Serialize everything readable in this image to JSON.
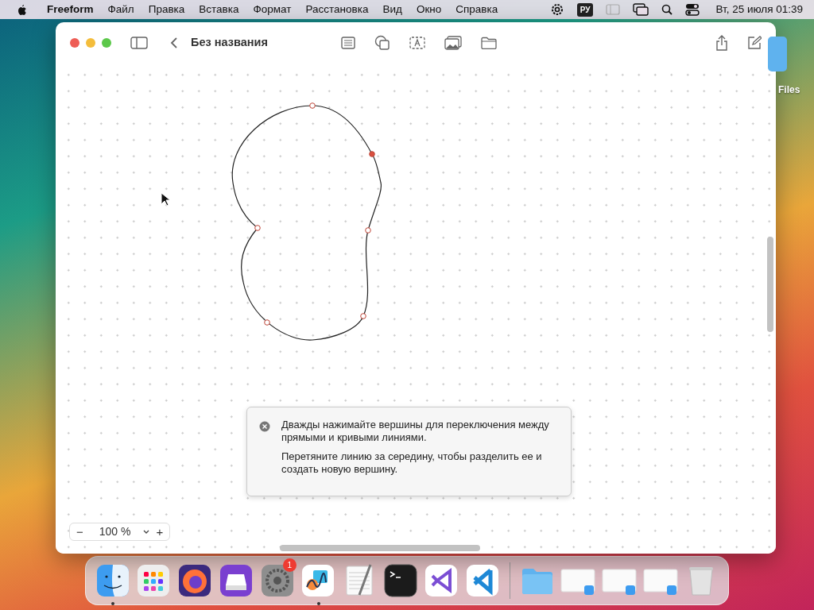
{
  "menubar": {
    "app_name": "Freeform",
    "menus": [
      "Файл",
      "Правка",
      "Вставка",
      "Формат",
      "Расстановка",
      "Вид",
      "Окно",
      "Справка"
    ],
    "input_language": "РУ",
    "clock": "Вт, 25 июля  01:39"
  },
  "desktop_icon": {
    "label": "Files"
  },
  "window": {
    "title": "Без названия"
  },
  "tooltip": {
    "paragraphs": [
      "Дважды нажимайте вершины для переключения между прямыми и кривыми линиями.",
      "Перетяните линию за середину, чтобы разделить ее и создать новую вершину."
    ]
  },
  "zoom_control": {
    "minus": "−",
    "value": "100 %",
    "plus": "+"
  },
  "shape": {
    "points": [
      {
        "selected": false
      },
      {
        "selected": true
      },
      {
        "selected": false
      },
      {
        "selected": false
      },
      {
        "selected": false
      },
      {
        "selected": false
      }
    ]
  },
  "dock": {
    "items": [
      {
        "kind": "finder",
        "running": true
      },
      {
        "kind": "launchpad",
        "running": false
      },
      {
        "kind": "firefox",
        "running": false
      },
      {
        "kind": "configurator",
        "running": false
      },
      {
        "kind": "settings",
        "running": false,
        "badge": "1"
      },
      {
        "kind": "freeform",
        "running": true
      },
      {
        "kind": "textedit",
        "running": false
      },
      {
        "kind": "terminal",
        "running": false
      },
      {
        "kind": "visualstudio",
        "running": false
      },
      {
        "kind": "vscode",
        "running": false
      },
      {
        "kind": "separator"
      },
      {
        "kind": "folder",
        "running": false
      },
      {
        "kind": "window",
        "running": false
      },
      {
        "kind": "window",
        "running": false
      },
      {
        "kind": "window",
        "running": false
      },
      {
        "kind": "trash",
        "running": false
      }
    ]
  }
}
